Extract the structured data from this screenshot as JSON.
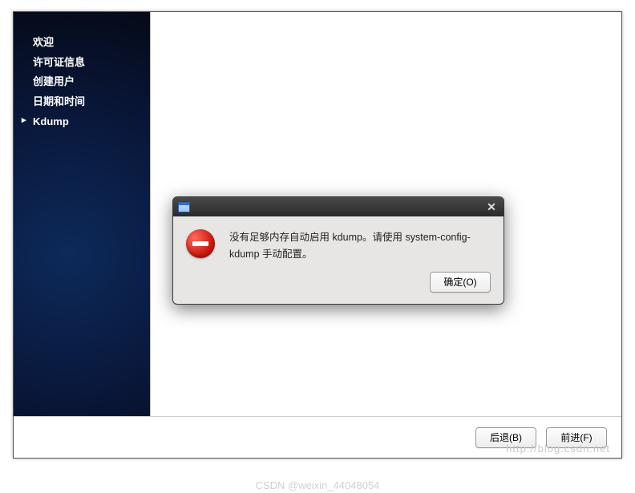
{
  "sidebar": {
    "items": [
      {
        "label": "欢迎"
      },
      {
        "label": "许可证信息"
      },
      {
        "label": "创建用户"
      },
      {
        "label": "日期和时间"
      },
      {
        "label": "Kdump",
        "current": true
      }
    ]
  },
  "footer": {
    "back_label": "后退(B)",
    "forward_label": "前进(F)"
  },
  "dialog": {
    "message": "没有足够内存自动启用 kdump。请使用 system-config-kdump 手动配置。",
    "ok_label": "确定(O)"
  },
  "watermark": {
    "blog": "http://blog.csdn.net",
    "csdn": "CSDN @weixin_44048054"
  }
}
